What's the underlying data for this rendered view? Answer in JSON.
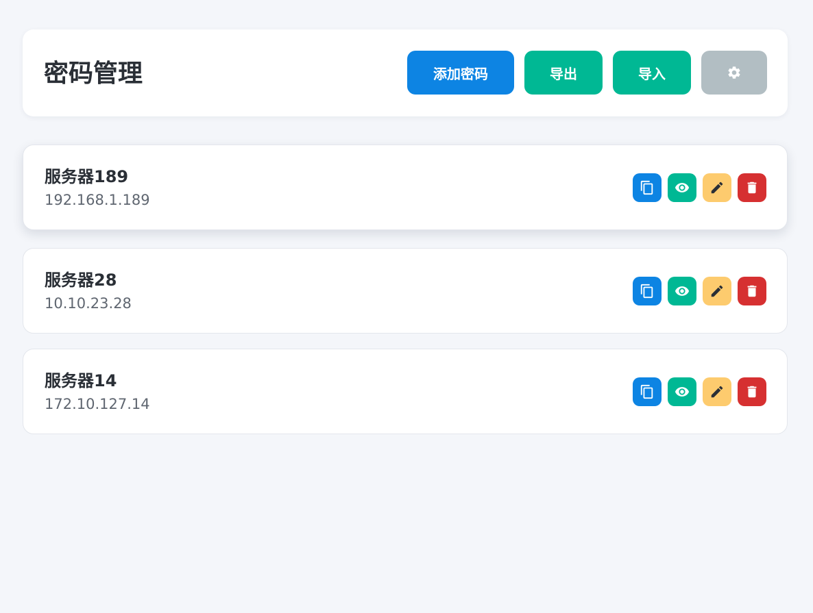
{
  "header": {
    "title": "密码管理",
    "add_label": "添加密码",
    "export_label": "导出",
    "import_label": "导入",
    "settings_icon": "gear-icon"
  },
  "colors": {
    "background": "#f4f6fa",
    "primary": "#0d84e3",
    "success": "#00b894",
    "warning": "#fdcb6e",
    "danger": "#d63031",
    "muted": "#b2bec3",
    "title_text": "#2a2f36",
    "sub_text": "#5f6670"
  },
  "entries": [
    {
      "name": "服务器189",
      "host": "192.168.1.189"
    },
    {
      "name": "服务器28",
      "host": "10.10.23.28"
    },
    {
      "name": "服务器14",
      "host": "172.10.127.14"
    }
  ],
  "entry_actions": [
    {
      "icon": "copy-icon",
      "color": "#0d84e3"
    },
    {
      "icon": "eye-icon",
      "color": "#00b894"
    },
    {
      "icon": "pencil-icon",
      "color": "#fdcb6e"
    },
    {
      "icon": "trash-icon",
      "color": "#d63031"
    }
  ]
}
